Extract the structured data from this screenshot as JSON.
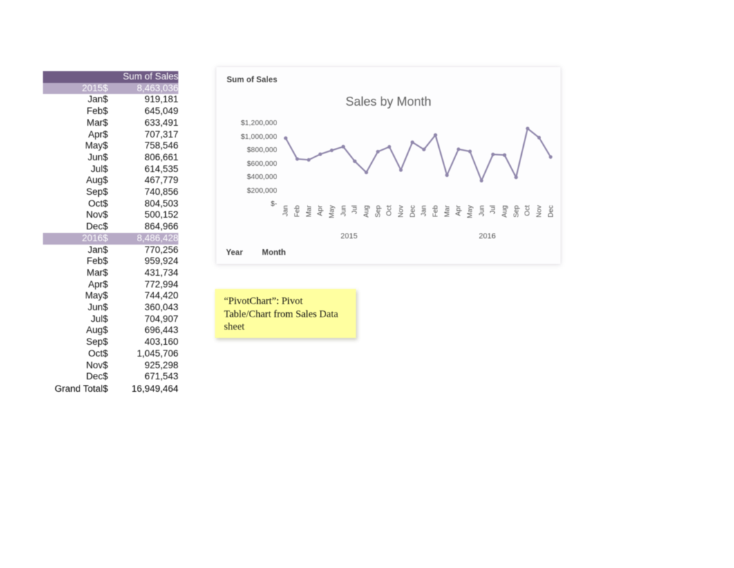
{
  "pivot_table": {
    "header": {
      "blank_label": "",
      "value_label": "Sum of Sales"
    },
    "currency_symbol": "$",
    "groups": [
      {
        "year": "2015",
        "total": "8,463,036",
        "months": [
          {
            "label": "Jan",
            "value": "919,181"
          },
          {
            "label": "Feb",
            "value": "645,049"
          },
          {
            "label": "Mar",
            "value": "633,491"
          },
          {
            "label": "Apr",
            "value": "707,317"
          },
          {
            "label": "May",
            "value": "758,546"
          },
          {
            "label": "Jun",
            "value": "806,661"
          },
          {
            "label": "Jul",
            "value": "614,535"
          },
          {
            "label": "Aug",
            "value": "467,779"
          },
          {
            "label": "Sep",
            "value": "740,856"
          },
          {
            "label": "Oct",
            "value": "804,503"
          },
          {
            "label": "Nov",
            "value": "500,152"
          },
          {
            "label": "Dec",
            "value": "864,966"
          }
        ]
      },
      {
        "year": "2016",
        "total": "8,486,428",
        "months": [
          {
            "label": "Jan",
            "value": "770,256"
          },
          {
            "label": "Feb",
            "value": "959,924"
          },
          {
            "label": "Mar",
            "value": "431,734"
          },
          {
            "label": "Apr",
            "value": "772,994"
          },
          {
            "label": "May",
            "value": "744,420"
          },
          {
            "label": "Jun",
            "value": "360,043"
          },
          {
            "label": "Jul",
            "value": "704,907"
          },
          {
            "label": "Aug",
            "value": "696,443"
          },
          {
            "label": "Sep",
            "value": "403,160"
          },
          {
            "label": "Oct",
            "value": "1,045,706"
          },
          {
            "label": "Nov",
            "value": "925,298"
          },
          {
            "label": "Dec",
            "value": "671,543"
          }
        ]
      }
    ],
    "grand_total": {
      "label": "Grand Total",
      "value": "16,949,464"
    },
    "colors": {
      "header_bg": "#6f5b84",
      "group_bg": "#b7aac6",
      "header_text": "#ffffff"
    }
  },
  "chart_panel": {
    "legend_field_label": "Sum of Sales",
    "field_buttons": {
      "year": "Year",
      "month": "Month"
    }
  },
  "note": {
    "text": "“PivotChart”: Pivot Table/Chart from Sales Data sheet",
    "background_color": "#ffffa0"
  },
  "chart_data": {
    "type": "line",
    "title": "Sales by Month",
    "xlabel": "",
    "ylabel": "",
    "legend_entries": [
      "Sum of Sales"
    ],
    "legend_position": "top-left",
    "grid": false,
    "line_color": "#8f86ab",
    "markers": true,
    "ylim": [
      0,
      1200000
    ],
    "ytick_labels": [
      "$1,200,000",
      "$1,000,000",
      "$800,000",
      "$600,000",
      "$400,000",
      "$200,000",
      "$-"
    ],
    "yticks": [
      1200000,
      1000000,
      800000,
      600000,
      400000,
      200000,
      0
    ],
    "group_labels": [
      "2015",
      "2016"
    ],
    "categories": [
      "Jan",
      "Feb",
      "Mar",
      "Apr",
      "May",
      "Jun",
      "Jul",
      "Aug",
      "Sep",
      "Oct",
      "Nov",
      "Dec",
      "Jan",
      "Feb",
      "Mar",
      "Apr",
      "May",
      "Jun",
      "Jul",
      "Aug",
      "Sep",
      "Oct",
      "Nov",
      "Dec"
    ],
    "values": [
      919181,
      645049,
      633491,
      707317,
      758546,
      806661,
      614535,
      467779,
      740856,
      804503,
      500152,
      864966,
      770256,
      959924,
      431734,
      772994,
      744420,
      360043,
      704907,
      696443,
      403160,
      1045706,
      925298,
      671543
    ]
  }
}
